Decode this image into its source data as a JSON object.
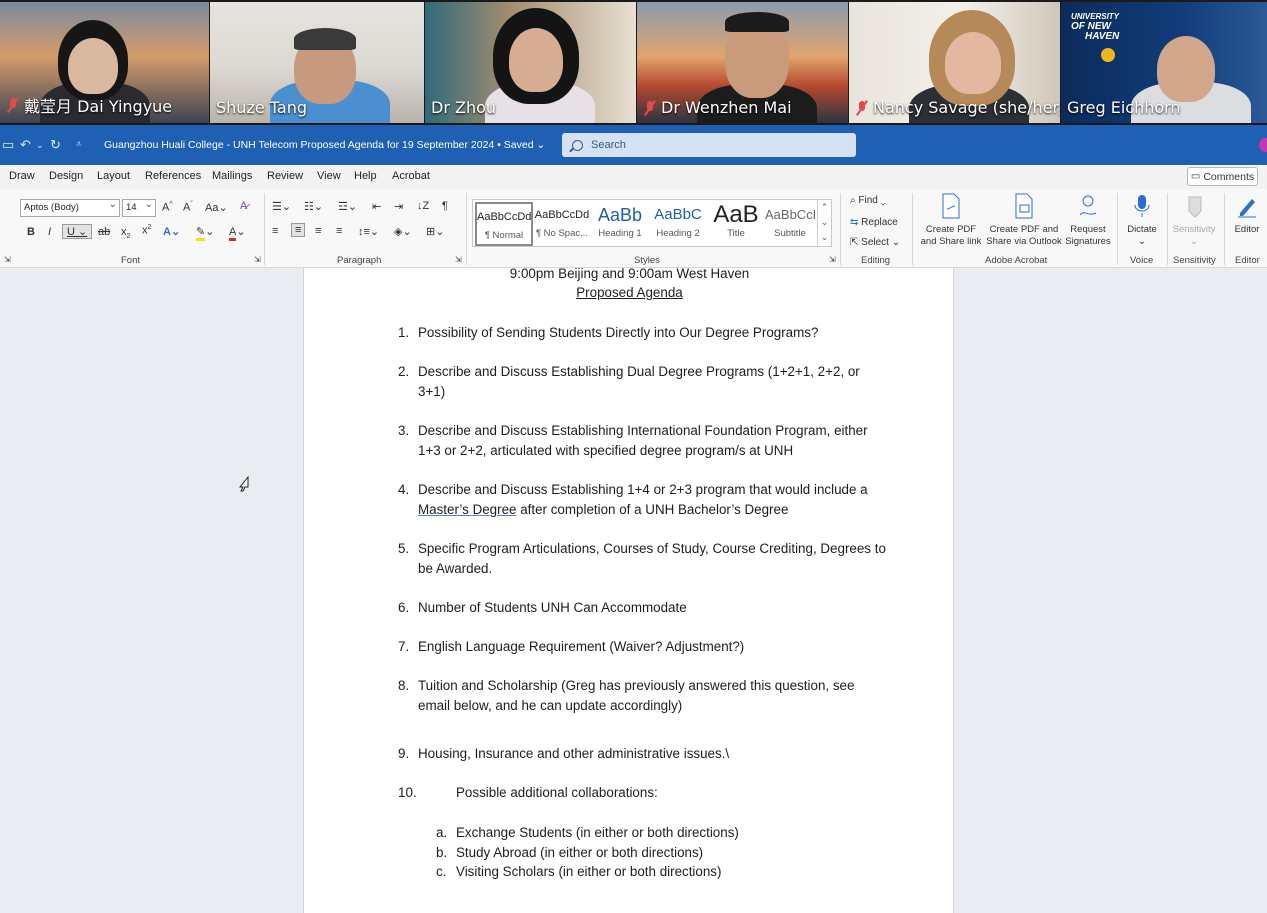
{
  "meeting": {
    "participants": [
      {
        "name": "戴莹月 Dai Yingyue",
        "muted": true
      },
      {
        "name": "Shuze Tang",
        "muted": false,
        "active_speaker": true
      },
      {
        "name": "Dr Zhou",
        "muted": false
      },
      {
        "name": "Dr Wenzhen Mai",
        "muted": true
      },
      {
        "name": "Nancy Savage (she/her/...",
        "muted": true
      },
      {
        "name": "Greg Eichhorn",
        "muted": false
      }
    ],
    "logo_text": [
      "UNIVERSITY",
      "OF NEW",
      "HAVEN"
    ]
  },
  "titlebar": {
    "doc_title": "Guangzhou Huali College - UNH Telecom Proposed Agenda for 19 September 2024 • Saved ⌄",
    "search_placeholder": "Search"
  },
  "ribbon": {
    "tabs": [
      "Draw",
      "Design",
      "Layout",
      "References",
      "Mailings",
      "Review",
      "View",
      "Help",
      "Acrobat"
    ],
    "comments_label": "Comments",
    "font": {
      "name": "Aptos (Body)",
      "size": "14",
      "group_label": "Font"
    },
    "paragraph_label": "Paragraph",
    "styles": [
      {
        "preview": "AaBbCcDd",
        "name": "¶ Normal"
      },
      {
        "preview": "AaBbCcDd",
        "name": "¶ No Spac..."
      },
      {
        "preview": "AaBb",
        "name": "Heading 1"
      },
      {
        "preview": "AaBbC",
        "name": "Heading 2"
      },
      {
        "preview": "AaB",
        "name": "Title"
      },
      {
        "preview": "AaBbCcD",
        "name": "Subtitle"
      }
    ],
    "styles_label": "Styles",
    "editing": {
      "find": "Find",
      "replace": "Replace",
      "select": "Select",
      "group_label": "Editing"
    },
    "acrobat": {
      "btn1": [
        "Create PDF",
        "and Share link"
      ],
      "btn2": [
        "Create PDF and",
        "Share via Outlook"
      ],
      "btn3": [
        "Request",
        "Signatures"
      ],
      "group_label": "Adobe Acrobat"
    },
    "voice": {
      "btn": "Dictate",
      "group_label": "Voice"
    },
    "sensitivity": {
      "btn": "Sensitivity",
      "group_label": "Sensitivity"
    },
    "editor": {
      "btn": "Editor",
      "group_label": "Editor"
    }
  },
  "document": {
    "time_line": "9:00pm Beijing and 9:00am West Haven",
    "heading": "Proposed Agenda",
    "items": [
      {
        "num": "1.",
        "text": "Possibility of Sending Students Directly into Our Degree Programs?"
      },
      {
        "num": "2.",
        "text": "Describe and Discuss Establishing Dual Degree Programs (1+2+1, 2+2, or 3+1)"
      },
      {
        "num": "3.",
        "text": "Describe and Discuss Establishing International Foundation Program, either 1+3 or 2+2, articulated with specified degree program/s at UNH"
      },
      {
        "num": "4.",
        "text_before": "Describe and Discuss Establishing 1+4 or 2+3 program that would include a ",
        "text_underlined": "Master’s Degree",
        "text_after": " after completion of a UNH Bachelor’s Degree"
      },
      {
        "num": "5.",
        "text": "Specific Program Articulations, Courses of Study, Course Crediting, Degrees to be Awarded."
      },
      {
        "num": "6.",
        "text": "Number of Students UNH Can Accommodate"
      },
      {
        "num": "7.",
        "text": "English Language Requirement (Waiver? Adjustment?)"
      },
      {
        "num": "8.",
        "text": "Tuition and Scholarship (Greg has previously answered this question, see email below, and he can update accordingly)"
      },
      {
        "num": "9.",
        "text": "Housing, Insurance and other administrative issues.\\"
      },
      {
        "num": "10.",
        "text": "Possible additional collaborations:"
      }
    ],
    "subitems": [
      {
        "num": "a.",
        "text": "Exchange Students (in either or both directions)"
      },
      {
        "num": "b.",
        "text": "Study Abroad (in either or both directions)"
      },
      {
        "num": "c.",
        "text": "Visiting Scholars (in either or both directions)"
      }
    ]
  }
}
